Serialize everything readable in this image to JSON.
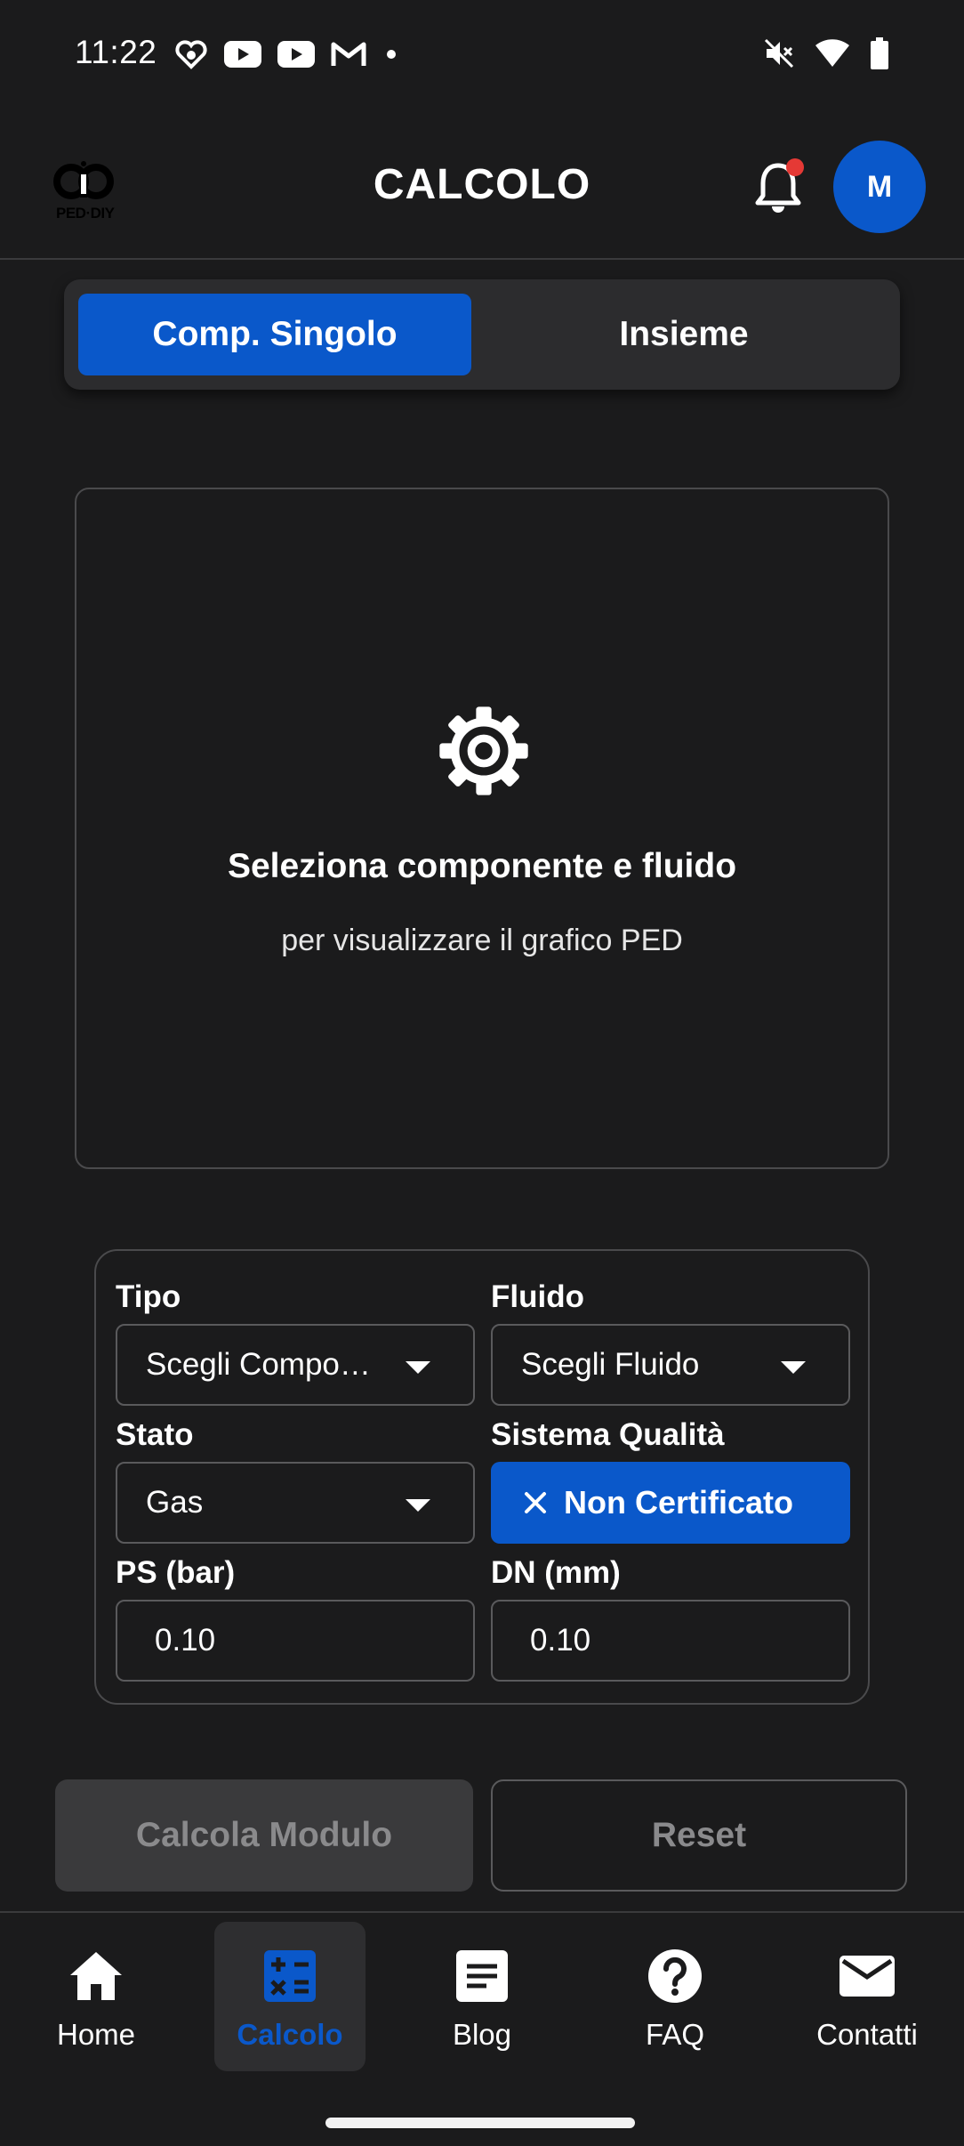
{
  "status_bar": {
    "time": "11:22",
    "left_icons": [
      "heart-link-icon",
      "youtube-icon",
      "youtube-icon",
      "gmail-icon",
      "dot-icon"
    ],
    "right_icons": [
      "mute-icon",
      "wifi-icon",
      "battery-icon"
    ]
  },
  "header": {
    "logo_text": "PED·DIY",
    "title": "CALCOLO",
    "avatar_initial": "M",
    "notification_dot_color": "#e53935"
  },
  "tabs": [
    {
      "label": "Comp. Singolo",
      "active": true
    },
    {
      "label": "Insieme",
      "active": false
    }
  ],
  "placeholder": {
    "icon": "gear-icon",
    "title": "Seleziona componente e fluido",
    "subtitle": "per visualizzare il grafico PED"
  },
  "form": {
    "tipo": {
      "label": "Tipo",
      "value": "Scegli Compo…"
    },
    "fluido": {
      "label": "Fluido",
      "value": "Scegli Fluido"
    },
    "stato": {
      "label": "Stato",
      "value": "Gas"
    },
    "sistema_qualita": {
      "label": "Sistema Qualità",
      "value": "Non Certificato"
    },
    "ps": {
      "label": "PS (bar)",
      "value": "0.10"
    },
    "dn": {
      "label": "DN (mm)",
      "value": "0.10"
    }
  },
  "actions": {
    "calc_label": "Calcola Modulo",
    "reset_label": "Reset"
  },
  "nav": [
    {
      "label": "Home",
      "icon": "home-icon",
      "active": false
    },
    {
      "label": "Calcolo",
      "icon": "calculator-icon",
      "active": true
    },
    {
      "label": "Blog",
      "icon": "article-icon",
      "active": false
    },
    {
      "label": "FAQ",
      "icon": "help-icon",
      "active": false
    },
    {
      "label": "Contatti",
      "icon": "mail-icon",
      "active": false
    }
  ],
  "colors": {
    "accent": "#0a58ca",
    "background": "#1b1b1c",
    "surface": "#2c2c2e",
    "border": "#4a4a4c",
    "disabled_text": "#8a8a8c"
  }
}
